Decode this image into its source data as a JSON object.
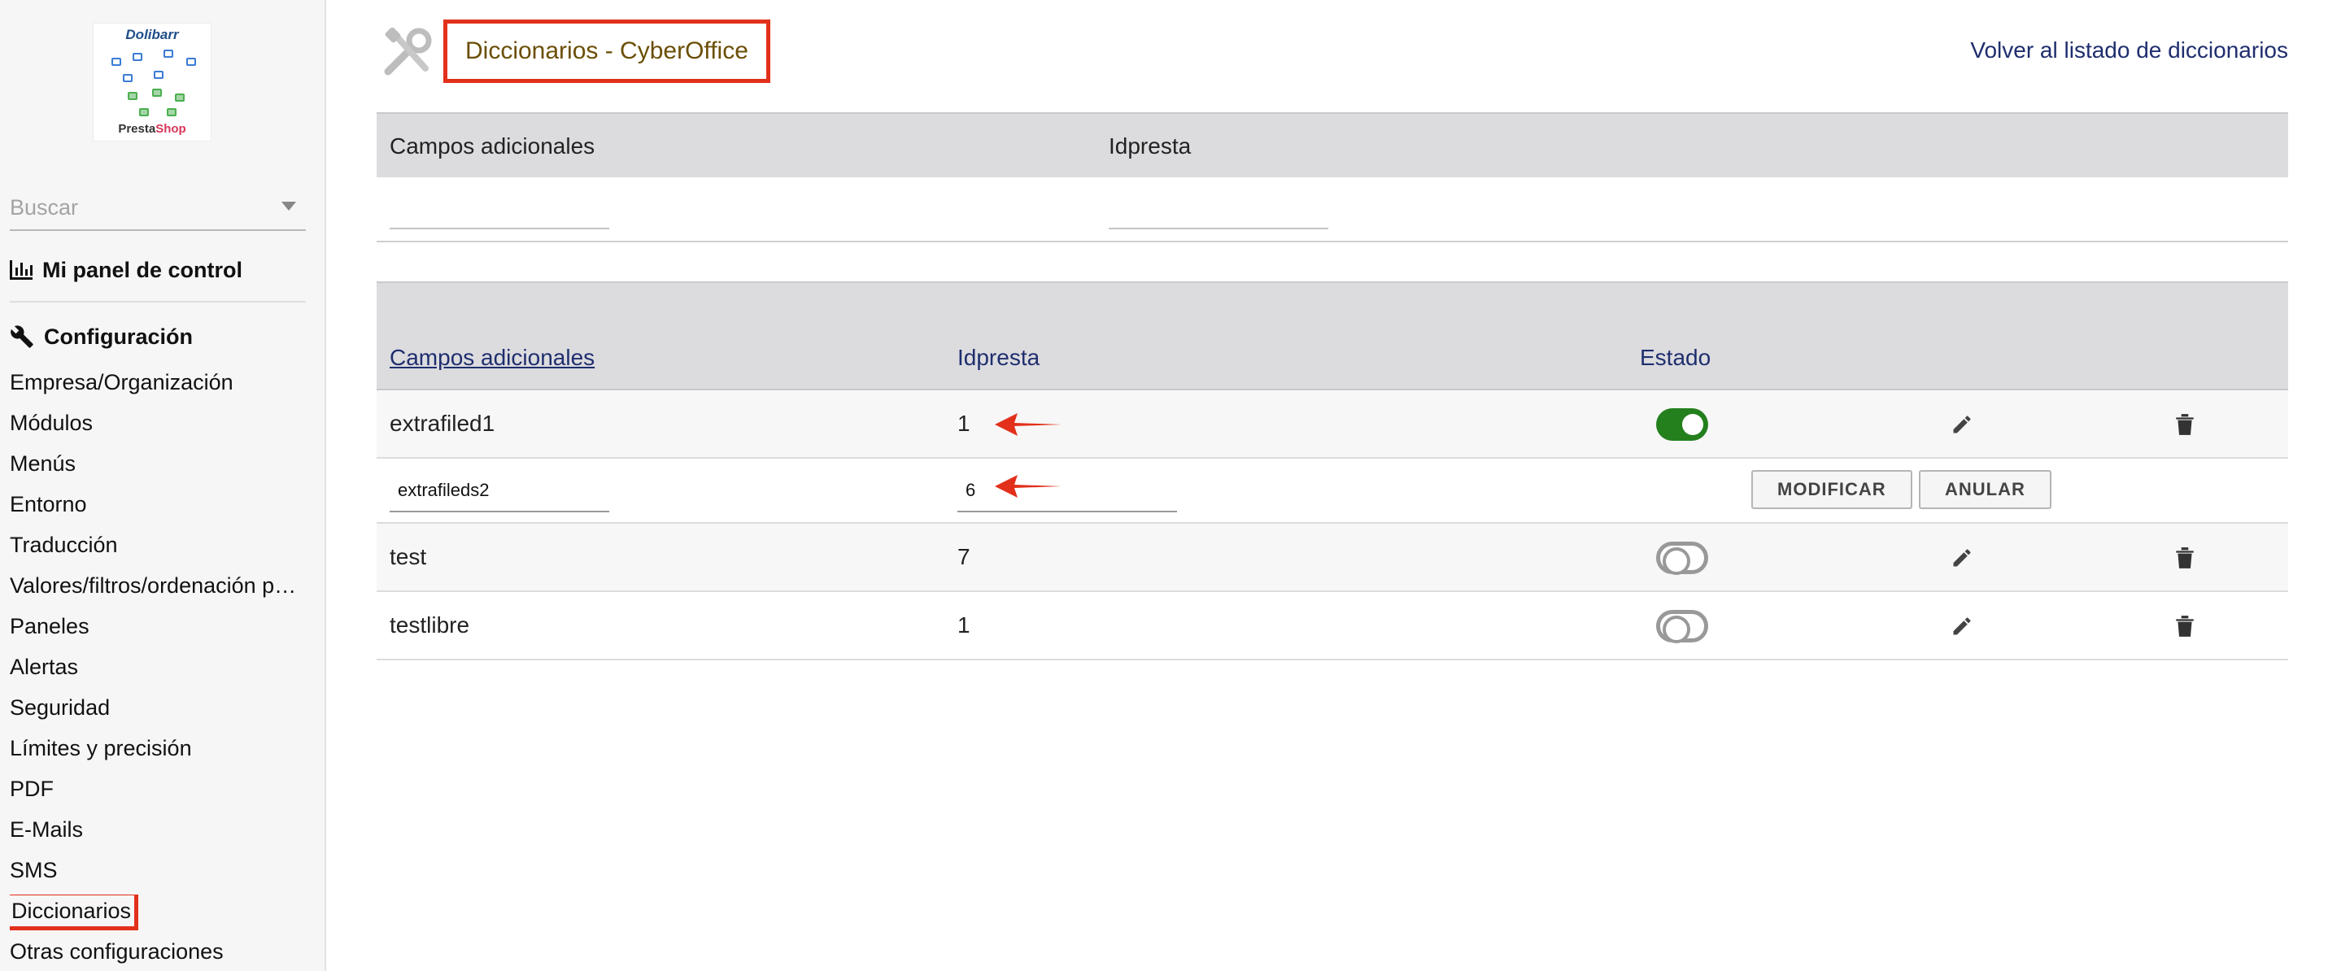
{
  "sidebar": {
    "logo": {
      "brand_top": "Dolibarr",
      "brand_presta": "Presta",
      "brand_shop": "Shop"
    },
    "search_placeholder": "Buscar",
    "dashboard_label": "Mi panel de control",
    "section_label": "Configuración",
    "menu": [
      "Empresa/Organización",
      "Módulos",
      "Menús",
      "Entorno",
      "Traducción",
      "Valores/filtros/ordenación p…",
      "Paneles",
      "Alertas",
      "Seguridad",
      "Límites y precisión",
      "PDF",
      "E-Mails",
      "SMS",
      "Diccionarios",
      "Otras configuraciones"
    ]
  },
  "main": {
    "title": "Diccionarios - CyberOffice",
    "back_link": "Volver al listado de diccionarios",
    "add_form": {
      "col_field": "Campos adicionales",
      "col_idpresta": "Idpresta",
      "field_value": "",
      "idpresta_value": ""
    },
    "list": {
      "col_field": "Campos adicionales",
      "col_idpresta": "Idpresta",
      "col_status": "Estado",
      "rows": [
        {
          "field": "extrafiled1",
          "idpresta": "1",
          "status": "on"
        },
        {
          "field": "extrafileds2",
          "idpresta": "6",
          "editing": true
        },
        {
          "field": "test",
          "idpresta": "7",
          "status": "off"
        },
        {
          "field": "testlibre",
          "idpresta": "1",
          "status": "off"
        }
      ],
      "modify_button": "MODIFICAR",
      "cancel_button": "ANULAR"
    }
  },
  "colors": {
    "highlight_border": "#e2301b",
    "toggle_on": "#23801d",
    "title_text": "#6b4e05",
    "link_text": "#1f2e6e"
  },
  "icons": [
    "chart-icon",
    "wrench-icon",
    "tools-icon",
    "pencil-icon",
    "trash-icon",
    "red-arrow-icon"
  ]
}
